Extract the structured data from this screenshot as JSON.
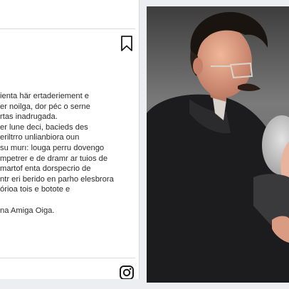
{
  "post": {
    "caption_lines": [
      "ienta här ertaderiement e",
      "er noilga, dor péc o serne",
      "rtas inadrugada.",
      "er lune deci, bacieds des",
      "eriltrro unlianbiora oun",
      "su murı: louga perru dovengo",
      "mpetrer e de dramr ar tuios de",
      "martof enta dorspecrio de",
      "ntr eri berido en parho elesbrora",
      "órioa tois e botote e",
      "",
      "na Amiga Oiga."
    ],
    "icons": {
      "bookmark": "bookmark-icon",
      "instagram": "instagram-icon"
    }
  },
  "photo": {
    "subject": "two-people-embracing-photo"
  },
  "colors": {
    "page_background": "#eceef1",
    "card_background": "#ffffff",
    "text": "#2b2b2b"
  }
}
